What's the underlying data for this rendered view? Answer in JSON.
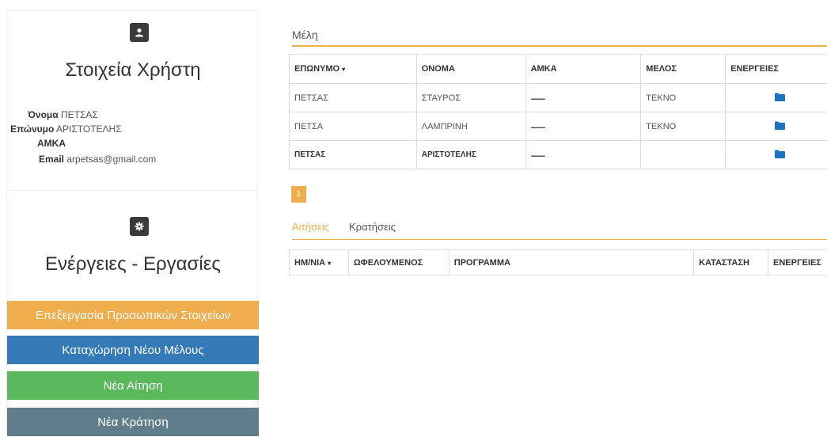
{
  "sidebar": {
    "user_section_title": "Στοιχεία Χρήστη",
    "user_info": {
      "name_label": "Όνομα",
      "name_value": "ΠΕΤΣΑΣ",
      "surname_label": "Επώνυμο",
      "surname_value": "ΑΡΙΣΤΟΤΕΛΗΣ",
      "amka_label": "ΑΜΚΑ",
      "amka_value": "",
      "email_label": "Email",
      "email_value": "arpetsas@gmail.com"
    },
    "actions_title": "Ενέργειες - Εργασίες",
    "actions": {
      "edit_personal": "Επεξεργασία Προσωπικών Στοιχείων",
      "new_member": "Καταχώρηση Νέου Μέλους",
      "new_application": "Νέα Αίτηση",
      "new_reservation": "Νέα Κράτηση"
    },
    "icons": [
      "user-icon",
      "gear-icon"
    ]
  },
  "members": {
    "title": "Μέλη",
    "columns": {
      "surname": "ΕΠΩΝΥΜΟ",
      "name": "ΟΝΟΜΑ",
      "amka": "ΑΜΚΑ",
      "member": "ΜΕΛΟΣ",
      "actions": "ΕΝΕΡΓΕΙΕΣ"
    },
    "sort_indicator": "▾",
    "rows": [
      {
        "surname": "ΠΕΤΣΑΣ",
        "name": "ΣΤΑΥΡΟΣ",
        "amka": "..........",
        "member": "ΤΕΚΝΟ"
      },
      {
        "surname": "ΠΕΤΣΑ",
        "name": "ΛΑΜΠΡΙΝΗ",
        "amka": "..........",
        "member": "ΤΕΚΝΟ"
      },
      {
        "surname": "ΠΕΤΣΑΣ",
        "name": "ΑΡΙΣΤΟΤΕΛΗΣ",
        "amka": "..........",
        "member": ""
      }
    ],
    "row_action_icon": "folder-icon",
    "pagination": {
      "current_page": "1"
    }
  },
  "tabs": {
    "applications": "Αιτήσεις",
    "reservations": "Κρατήσεις",
    "active": "applications"
  },
  "applications": {
    "columns": {
      "date": "ΗΜ/ΝΙΑ",
      "beneficiary": "ΩΦΕΛΟΥΜΕΝΟΣ",
      "program": "ΠΡΟΓΡΑΜΜΑ",
      "status": "ΚΑΤΑΣΤΑΣΗ",
      "actions": "ΕΝΕΡΓΕΙΕΣ"
    },
    "sort_indicator": "▾",
    "rows": []
  },
  "colors": {
    "accent_orange": "#f0ad4e",
    "primary_blue": "#337ab7",
    "success_green": "#5cb85c",
    "slate": "#607d8b",
    "folder_blue": "#1e73be",
    "icon_dark": "#3a3a3a"
  }
}
